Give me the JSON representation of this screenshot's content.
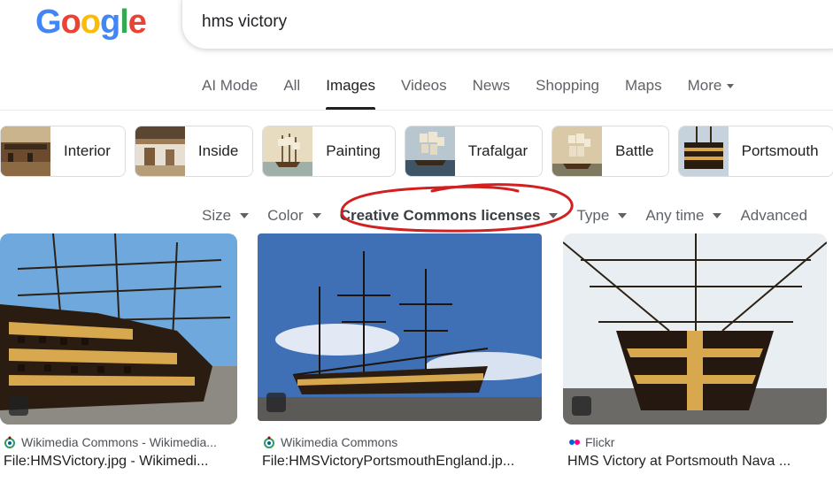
{
  "logo": {
    "letters": [
      "G",
      "o",
      "o",
      "g",
      "l",
      "e"
    ]
  },
  "search": {
    "query": "hms victory"
  },
  "tabs": [
    {
      "label": "AI Mode"
    },
    {
      "label": "All"
    },
    {
      "label": "Images",
      "active": true
    },
    {
      "label": "Videos"
    },
    {
      "label": "News"
    },
    {
      "label": "Shopping"
    },
    {
      "label": "Maps"
    },
    {
      "label": "More"
    }
  ],
  "chips": [
    "Interior",
    "Inside",
    "Painting",
    "Trafalgar",
    "Battle",
    "Portsmouth"
  ],
  "filters": [
    "Size",
    "Color",
    "Creative Commons licenses",
    "Type",
    "Any time",
    "Advanced"
  ],
  "results": [
    {
      "source": "Wikimedia Commons - Wikimedia...",
      "title": "File:HMSVictory.jpg - Wikimedi...",
      "source_icon": "wikimedia-icon"
    },
    {
      "source": "Wikimedia Commons",
      "title": "File:HMSVictoryPortsmouthEngland.jp...",
      "source_icon": "wikimedia-icon"
    },
    {
      "source": "Flickr",
      "title": "HMS Victory at Portsmouth Nava ...",
      "source_icon": "flickr-icon"
    }
  ],
  "colors": {
    "blue": "#4285F4",
    "red": "#EA4335",
    "yellow": "#FBBC05",
    "green": "#34A853",
    "annotation": "#d22020"
  }
}
